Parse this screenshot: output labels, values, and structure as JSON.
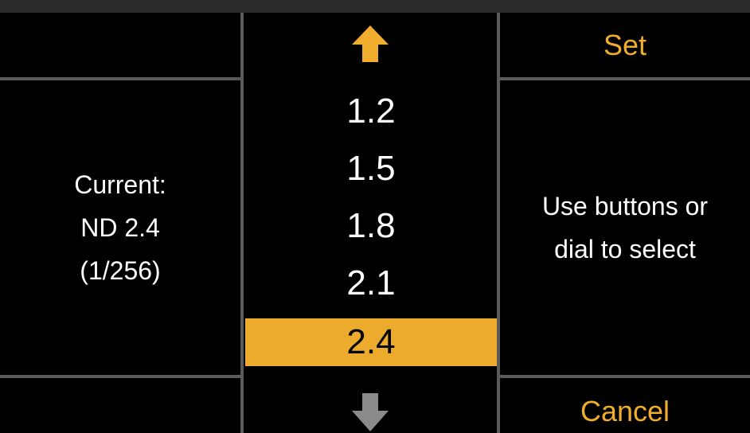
{
  "left_panel": {
    "line1": "Current:",
    "line2": "ND 2.4",
    "line3": "(1/256)"
  },
  "right_panel": {
    "set_label": "Set",
    "hint_line1": "Use buttons or",
    "hint_line2": "dial to select",
    "cancel_label": "Cancel"
  },
  "selector": {
    "up_icon": "arrow-up-icon",
    "down_icon": "arrow-down-icon",
    "options": [
      "1.2",
      "1.5",
      "1.8",
      "2.1",
      "2.4"
    ],
    "selected_index": 4
  },
  "colors": {
    "accent": "#edab2e",
    "up_arrow": "#f0ad2e",
    "down_arrow": "#8a8a8a",
    "divider": "#5a5a5a",
    "background": "#000000"
  }
}
